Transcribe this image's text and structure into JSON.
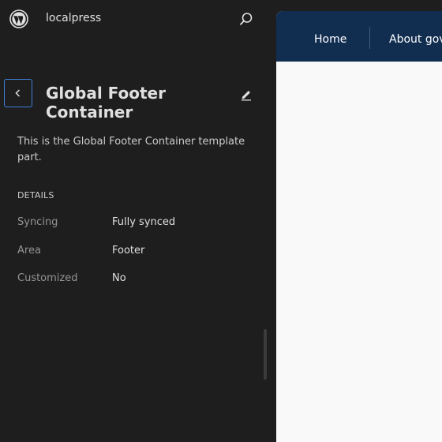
{
  "sidebar": {
    "site_name": "localpress",
    "title": "Global Footer Container",
    "description": "This is the Global Footer Container template part.",
    "details_heading": "DETAILS",
    "details": [
      {
        "label": "Syncing",
        "value": "Fully synced"
      },
      {
        "label": "Area",
        "value": "Footer"
      },
      {
        "label": "Customized",
        "value": "No"
      }
    ]
  },
  "icons": {
    "logo": "wordpress-icon",
    "search": "search-icon",
    "back": "chevron-left-icon",
    "edit": "pencil-icon"
  },
  "preview": {
    "nav": [
      "Home",
      "About gov"
    ]
  },
  "colors": {
    "sidebar_bg": "#1e1e1e",
    "header_bg": "#112e51",
    "canvas_bg": "#f9f9f9",
    "focus_border": "#3f7fd8"
  }
}
